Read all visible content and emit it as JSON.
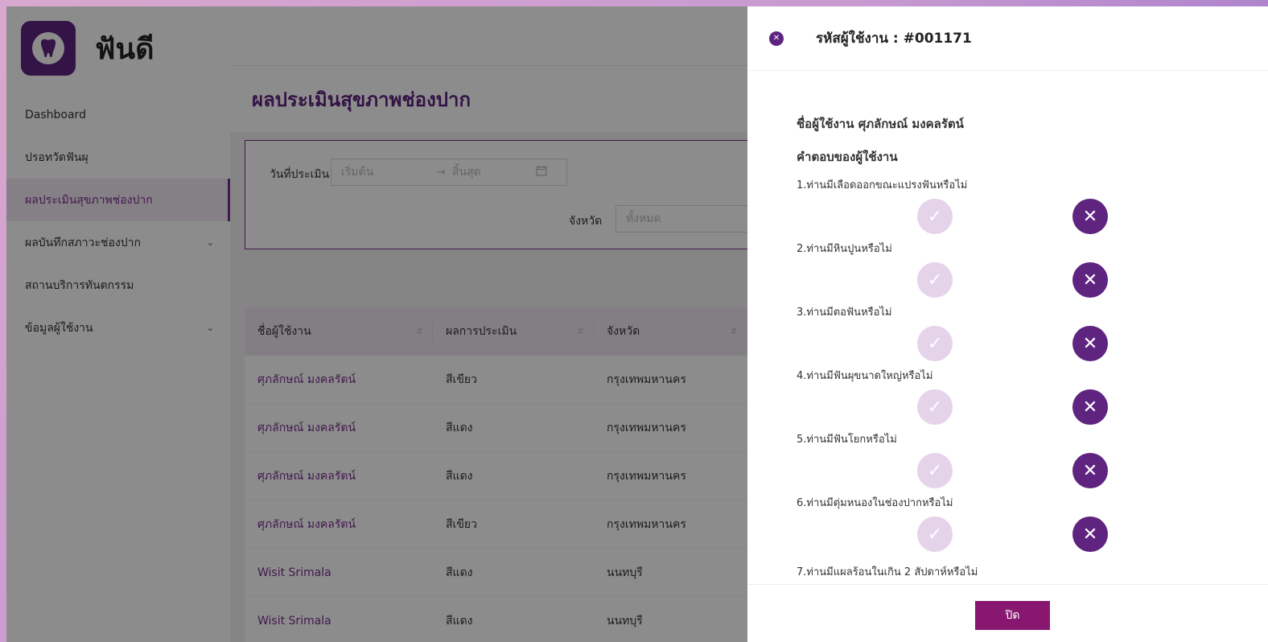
{
  "app": {
    "logo_text": "ฟันดี"
  },
  "sidebar": {
    "items": [
      {
        "label": "Dashboard"
      },
      {
        "label": "ปรอทวัดฟันผุ"
      },
      {
        "label": "ผลประเมินสุขภาพช่องปาก"
      },
      {
        "label": "ผลบันทึกสภาวะช่องปาก"
      },
      {
        "label": "สถานบริการทันตกรรม"
      },
      {
        "label": "ข้อมูลผู้ใช้งาน"
      }
    ]
  },
  "page": {
    "title": "ผลประเมินสุขภาพช่องปาก"
  },
  "filter": {
    "date_label": "วันที่ประเมิน",
    "start_placeholder": "เริ่มต้น",
    "arrow": "→",
    "end_placeholder": "สิ้นสุด",
    "province_label": "จังหวัด",
    "province_placeholder": "ทั้งหมด"
  },
  "table": {
    "headers": [
      "ชื่อผู้ใช้งาน",
      "ผลการประเมิน",
      "จังหวัด"
    ],
    "rows": [
      [
        "ศุภลักษณ์ มงคลรัตน์",
        "สีเขียว",
        "กรุงเทพมหานคร"
      ],
      [
        "ศุภลักษณ์ มงคลรัตน์",
        "สีแดง",
        "กรุงเทพมหานคร"
      ],
      [
        "ศุภลักษณ์ มงคลรัตน์",
        "สีแดง",
        "กรุงเทพมหานคร"
      ],
      [
        "ศุภลักษณ์ มงคลรัตน์",
        "สีเขียว",
        "กรุงเทพมหานคร"
      ],
      [
        "Wisit Srimala",
        "สีแดง",
        "นนทบุรี"
      ],
      [
        "Wisit Srimala",
        "สีแดง",
        "นนทบุรี"
      ]
    ]
  },
  "drawer": {
    "title": "รหัสผู้ใช้งาน : #001171",
    "user_name_line": "ชื่อผู้ใช้งาน  ศุภลักษณ์ มงคลรัตน์",
    "answers_heading": "คำตอบของผู้ใช้งาน",
    "questions": [
      "1.ท่านมีเลือดออกขณะแปรงฟันหรือไม่",
      "2.ท่านมีหินปูนหรือไม่",
      "3.ท่านมีตอฟันหรือไม่",
      "4.ท่านมีฟันผุขนาดใหญ่หรือไม่",
      "5.ท่านมีฟันโยกหรือไม่",
      "6.ท่านมีตุ่มหนองในช่องปากหรือไม่",
      "7.ท่านมีแผลร้อนในเกิน 2 สัปดาห์หรือไม่"
    ],
    "yes_glyph": "✓",
    "no_glyph": "✕",
    "close_button": "ปิด"
  },
  "icons": {
    "close": "close-icon",
    "calendar": "calendar-icon",
    "sort": "sort-icon",
    "chevron": "chevron-down-icon",
    "tooth": "tooth-icon"
  },
  "colors": {
    "brand": "#5f2480",
    "accent": "#87176f",
    "selected_yes": "#e5d3ea"
  }
}
